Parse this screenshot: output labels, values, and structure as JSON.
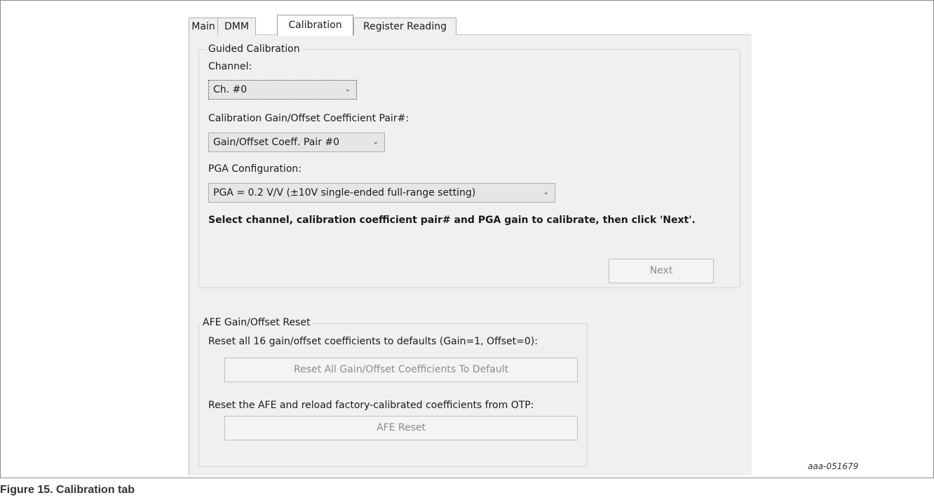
{
  "tabs": [
    {
      "label": "Main",
      "active": false
    },
    {
      "label": "DMM",
      "active": false
    },
    {
      "label": "Calibration",
      "active": true
    },
    {
      "label": "Register Reading",
      "active": false
    }
  ],
  "guided_calibration": {
    "title": "Guided Calibration",
    "channel_label": "Channel:",
    "channel_value": "Ch. #0",
    "pair_label": "Calibration Gain/Offset Coefficient Pair#:",
    "pair_value": "Gain/Offset Coeff. Pair #0",
    "pga_label": "PGA Configuration:",
    "pga_value": "PGA = 0.2 V/V (±10V single-ended full-range setting)",
    "instruction": "Select channel, calibration coefficient pair# and PGA gain to calibrate, then click 'Next'.",
    "next_label": "Next"
  },
  "afe_reset": {
    "title": "AFE Gain/Offset Reset",
    "reset_all_text": "Reset all 16 gain/offset coefficients to defaults (Gain=1, Offset=0):",
    "reset_all_button": "Reset All Gain/Offset Coefficients To Default",
    "reload_text": "Reset the AFE and reload factory-calibrated coefficients from OTP:",
    "afe_reset_button": "AFE Reset"
  },
  "image_id": "aaa-051679",
  "figure_caption": "Figure 15.  Calibration tab",
  "colors": {
    "panel_bg": "#f0f0f0",
    "disabled_text": "#8c8c8c",
    "active_tab_bg": "#ffffff"
  },
  "icons": {
    "dropdown": "chevron-down-icon"
  }
}
